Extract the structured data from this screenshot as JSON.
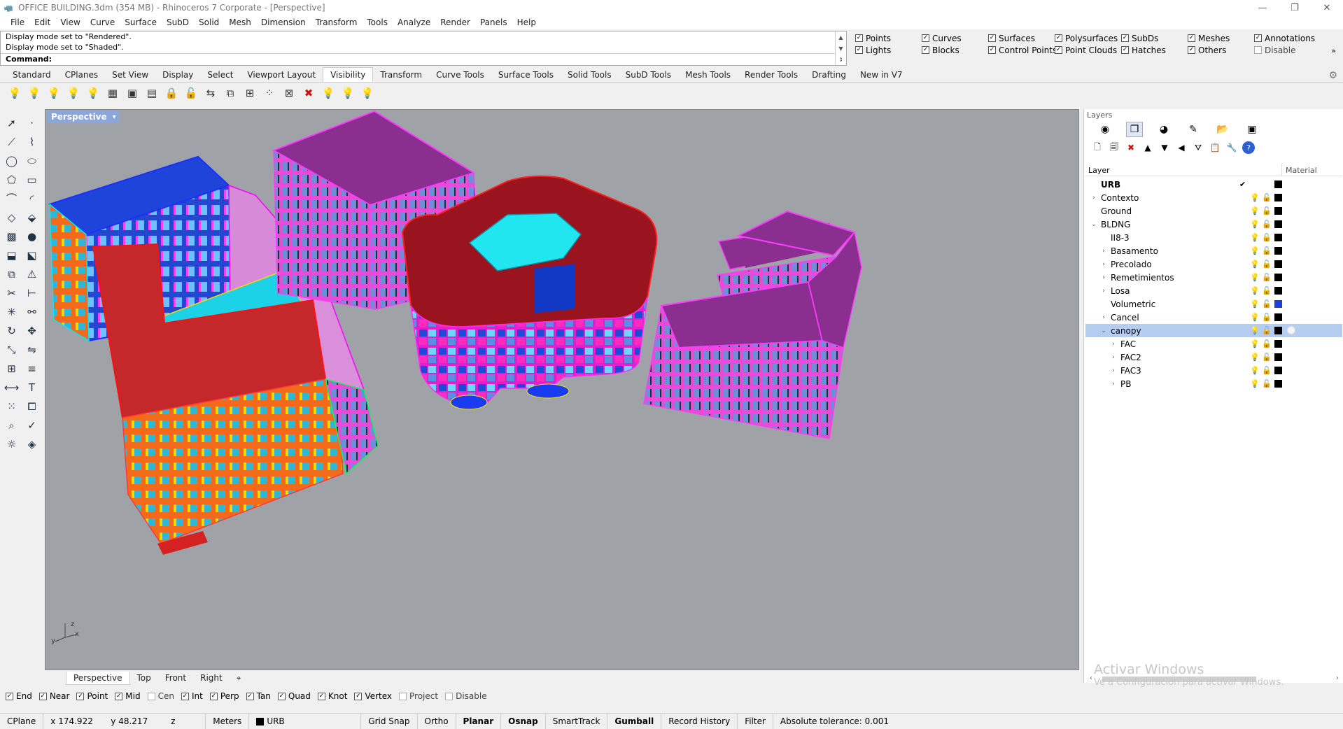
{
  "window": {
    "title": "OFFICE BUILDING.3dm (354 MB) - Rhinoceros 7 Corporate - [Perspective]",
    "minimize": "—",
    "restore": "❐",
    "close": "✕"
  },
  "menu": [
    "File",
    "Edit",
    "View",
    "Curve",
    "Surface",
    "SubD",
    "Solid",
    "Mesh",
    "Dimension",
    "Transform",
    "Tools",
    "Analyze",
    "Render",
    "Panels",
    "Help"
  ],
  "command_history": [
    "Display mode set to \"Rendered\".",
    "Display mode set to \"Shaded\"."
  ],
  "command_label": "Command:",
  "command_value": "",
  "selection_filter": [
    {
      "label": "Points",
      "checked": true
    },
    {
      "label": "Curves",
      "checked": true
    },
    {
      "label": "Surfaces",
      "checked": true
    },
    {
      "label": "Polysurfaces",
      "checked": true
    },
    {
      "label": "SubDs",
      "checked": true
    },
    {
      "label": "Meshes",
      "checked": true
    },
    {
      "label": "Annotations",
      "checked": true
    },
    {
      "label": "Lights",
      "checked": true
    },
    {
      "label": "Blocks",
      "checked": true
    },
    {
      "label": "Control Points",
      "checked": true
    },
    {
      "label": "Point Clouds",
      "checked": true
    },
    {
      "label": "Hatches",
      "checked": true
    },
    {
      "label": "Others",
      "checked": true
    },
    {
      "label": "Disable",
      "checked": false
    }
  ],
  "toolbar_tabs": [
    {
      "label": "Standard"
    },
    {
      "label": "CPlanes"
    },
    {
      "label": "Set View"
    },
    {
      "label": "Display"
    },
    {
      "label": "Select"
    },
    {
      "label": "Viewport Layout"
    },
    {
      "label": "Visibility",
      "active": true
    },
    {
      "label": "Transform"
    },
    {
      "label": "Curve Tools"
    },
    {
      "label": "Surface Tools"
    },
    {
      "label": "Solid Tools"
    },
    {
      "label": "SubD Tools"
    },
    {
      "label": "Mesh Tools"
    },
    {
      "label": "Render Tools"
    },
    {
      "label": "Drafting"
    },
    {
      "label": "New in V7"
    }
  ],
  "visibility_tools": [
    {
      "icon": "lightbulb-icon",
      "glyph": "💡",
      "kind": "bulb"
    },
    {
      "icon": "lightbulb-outline-icon",
      "glyph": "💡",
      "kind": "bulb"
    },
    {
      "icon": "lightbulb-dim-icon",
      "glyph": "💡",
      "kind": "bulb"
    },
    {
      "icon": "lightbulb-select-icon",
      "glyph": "💡",
      "kind": "bulb"
    },
    {
      "icon": "lightbulb-swap-icon",
      "glyph": "💡",
      "kind": "bulb"
    },
    {
      "icon": "points-on-icon",
      "glyph": "▦",
      "kind": ""
    },
    {
      "icon": "points-off-icon",
      "glyph": "▣",
      "kind": ""
    },
    {
      "icon": "grips-icon",
      "glyph": "▤",
      "kind": ""
    },
    {
      "icon": "lock-icon",
      "glyph": "🔒",
      "kind": ""
    },
    {
      "icon": "unlock-icon",
      "glyph": "🔓",
      "kind": ""
    },
    {
      "icon": "lock-swap-icon",
      "glyph": "⇆",
      "kind": ""
    },
    {
      "icon": "lock-selected-icon",
      "glyph": "⧉",
      "kind": ""
    },
    {
      "icon": "lock-grid-icon",
      "glyph": "⊞",
      "kind": ""
    },
    {
      "icon": "grid-points-icon",
      "glyph": "⁘",
      "kind": ""
    },
    {
      "icon": "hide-in-detail-icon",
      "glyph": "⊠",
      "kind": ""
    },
    {
      "icon": "delete-hidden-icon",
      "glyph": "✖",
      "kind": "red"
    },
    {
      "icon": "show-layer-icon",
      "glyph": "💡",
      "kind": "bulb"
    },
    {
      "icon": "hide-layer-icon",
      "glyph": "💡",
      "kind": "bulb"
    },
    {
      "icon": "layer-bulb-icon",
      "glyph": "💡",
      "kind": "bulb"
    }
  ],
  "left_tools": [
    {
      "icon": "select-arrow-icon",
      "glyph": "➚"
    },
    {
      "icon": "point-icon",
      "glyph": "·"
    },
    {
      "icon": "polyline-icon",
      "glyph": "⟋"
    },
    {
      "icon": "curve-icon",
      "glyph": "⌇"
    },
    {
      "icon": "circle-icon",
      "glyph": "◯"
    },
    {
      "icon": "ellipse-icon",
      "glyph": "⬭"
    },
    {
      "icon": "polygon-icon",
      "glyph": "⬠"
    },
    {
      "icon": "rectangle-icon",
      "glyph": "▭"
    },
    {
      "icon": "arc-icon",
      "glyph": "⌒"
    },
    {
      "icon": "fillet-icon",
      "glyph": "◜"
    },
    {
      "icon": "surface-icon",
      "glyph": "◇"
    },
    {
      "icon": "loft-icon",
      "glyph": "⬙"
    },
    {
      "icon": "box-icon",
      "glyph": "▩"
    },
    {
      "icon": "sphere-icon",
      "glyph": "●"
    },
    {
      "icon": "extrude-icon",
      "glyph": "⬓"
    },
    {
      "icon": "mesh-icon",
      "glyph": "⬕"
    },
    {
      "icon": "boolean-union-icon",
      "glyph": "⧉"
    },
    {
      "icon": "boolean-diff-icon",
      "glyph": "⚠"
    },
    {
      "icon": "trim-icon",
      "glyph": "✂"
    },
    {
      "icon": "split-icon",
      "glyph": "⊢"
    },
    {
      "icon": "explode-icon",
      "glyph": "✳"
    },
    {
      "icon": "join-icon",
      "glyph": "⚯"
    },
    {
      "icon": "rotate-icon",
      "glyph": "↻"
    },
    {
      "icon": "move-icon",
      "glyph": "✥"
    },
    {
      "icon": "scale-icon",
      "glyph": "⤡"
    },
    {
      "icon": "mirror-icon",
      "glyph": "⇋"
    },
    {
      "icon": "array-icon",
      "glyph": "⊞"
    },
    {
      "icon": "align-icon",
      "glyph": "≡"
    },
    {
      "icon": "dimension-icon",
      "glyph": "⟷"
    },
    {
      "icon": "text-icon",
      "glyph": "T"
    },
    {
      "icon": "grid-array-icon",
      "glyph": "⁙"
    },
    {
      "icon": "block-icon",
      "glyph": "⧠"
    },
    {
      "icon": "analyze-icon",
      "glyph": "⌕"
    },
    {
      "icon": "check-icon",
      "glyph": "✓"
    },
    {
      "icon": "render-icon",
      "glyph": "☼"
    },
    {
      "icon": "material-icon",
      "glyph": "◈"
    }
  ],
  "viewport": {
    "label": "Perspective",
    "menu_caret": "▾",
    "axis": {
      "x": "x",
      "y": "y",
      "z": "z"
    }
  },
  "viewport_tabs": [
    {
      "label": "Perspective",
      "active": true
    },
    {
      "label": "Top"
    },
    {
      "label": "Front"
    },
    {
      "label": "Right"
    },
    {
      "label": "⌖"
    }
  ],
  "osnaps": [
    {
      "label": "End",
      "checked": true
    },
    {
      "label": "Near",
      "checked": true
    },
    {
      "label": "Point",
      "checked": true
    },
    {
      "label": "Mid",
      "checked": true
    },
    {
      "label": "Cen",
      "checked": false
    },
    {
      "label": "Int",
      "checked": true
    },
    {
      "label": "Perp",
      "checked": true
    },
    {
      "label": "Tan",
      "checked": true
    },
    {
      "label": "Quad",
      "checked": true
    },
    {
      "label": "Knot",
      "checked": true
    },
    {
      "label": "Vertex",
      "checked": true
    },
    {
      "label": "Project",
      "checked": false
    },
    {
      "label": "Disable",
      "checked": false
    }
  ],
  "status": {
    "cplane": "CPlane",
    "x": "x 174.922",
    "y": "y 48.217",
    "z": "z",
    "units": "Meters",
    "layer": "URB",
    "toggles": [
      {
        "label": "Grid Snap",
        "bold": false
      },
      {
        "label": "Ortho",
        "bold": false
      },
      {
        "label": "Planar",
        "bold": true
      },
      {
        "label": "Osnap",
        "bold": true
      },
      {
        "label": "SmartTrack",
        "bold": false
      },
      {
        "label": "Gumball",
        "bold": true
      },
      {
        "label": "Record History",
        "bold": false
      },
      {
        "label": "Filter",
        "bold": false
      }
    ],
    "tolerance": "Absolute tolerance: 0.001"
  },
  "layers_panel": {
    "title": "Layers",
    "tabs": [
      {
        "icon": "properties-icon",
        "glyph": "◉"
      },
      {
        "icon": "layers-icon",
        "glyph": "❐",
        "active": true
      },
      {
        "icon": "render-panel-icon",
        "glyph": "◕"
      },
      {
        "icon": "materials-icon",
        "glyph": "✎"
      },
      {
        "icon": "libraries-icon",
        "glyph": "📂"
      },
      {
        "icon": "display-icon",
        "glyph": "▣"
      }
    ],
    "tools": [
      {
        "icon": "new-layer-icon",
        "glyph": "🗋"
      },
      {
        "icon": "new-sublayer-icon",
        "glyph": "🗐"
      },
      {
        "icon": "delete-layer-icon",
        "glyph": "✖"
      },
      {
        "icon": "move-up-icon",
        "glyph": "▲"
      },
      {
        "icon": "move-down-icon",
        "glyph": "▼"
      },
      {
        "icon": "move-parent-icon",
        "glyph": "◀"
      },
      {
        "icon": "filter-icon",
        "glyph": "⛛"
      },
      {
        "icon": "clipboard-icon",
        "glyph": "📋"
      },
      {
        "icon": "tools-icon",
        "glyph": "🔧"
      },
      {
        "icon": "help-icon",
        "glyph": "?"
      }
    ],
    "col_layer": "Layer",
    "col_material": "Material",
    "rows": [
      {
        "name": "URB",
        "depth": 0,
        "expand": "",
        "current": true,
        "swatch": "black"
      },
      {
        "name": "Contexto",
        "depth": 0,
        "expand": "›",
        "swatch": "black"
      },
      {
        "name": "Ground",
        "depth": 0,
        "expand": "",
        "swatch": "black"
      },
      {
        "name": "BLDNG",
        "depth": 0,
        "expand": "⌄",
        "swatch": "black"
      },
      {
        "name": "II8-3",
        "depth": 1,
        "expand": "",
        "swatch": "black"
      },
      {
        "name": "Basamento",
        "depth": 1,
        "expand": "›",
        "swatch": "black"
      },
      {
        "name": "Precolado",
        "depth": 1,
        "expand": "›",
        "swatch": "black"
      },
      {
        "name": "Remetimientos",
        "depth": 1,
        "expand": "›",
        "swatch": "black"
      },
      {
        "name": "Losa",
        "depth": 1,
        "expand": "›",
        "swatch": "black"
      },
      {
        "name": "Volumetric",
        "depth": 1,
        "expand": "",
        "swatch": "blue"
      },
      {
        "name": "Cancel",
        "depth": 1,
        "expand": "›",
        "swatch": "black"
      },
      {
        "name": "canopy",
        "depth": 1,
        "expand": "⌄",
        "swatch": "black",
        "selected": true
      },
      {
        "name": "FAC",
        "depth": 2,
        "expand": "›",
        "swatch": "black"
      },
      {
        "name": "FAC2",
        "depth": 2,
        "expand": "›",
        "swatch": "black"
      },
      {
        "name": "FAC3",
        "depth": 2,
        "expand": "›",
        "swatch": "black"
      },
      {
        "name": "PB",
        "depth": 2,
        "expand": "›",
        "swatch": "black"
      }
    ]
  },
  "watermark": {
    "line1": "Activar Windows",
    "line2": "Ve a Configuración para activar Windows."
  },
  "colors": {
    "viewport_bg": "#9fa3a8",
    "accent": "#8aa6da",
    "selected_row": "#b6cdf2"
  }
}
